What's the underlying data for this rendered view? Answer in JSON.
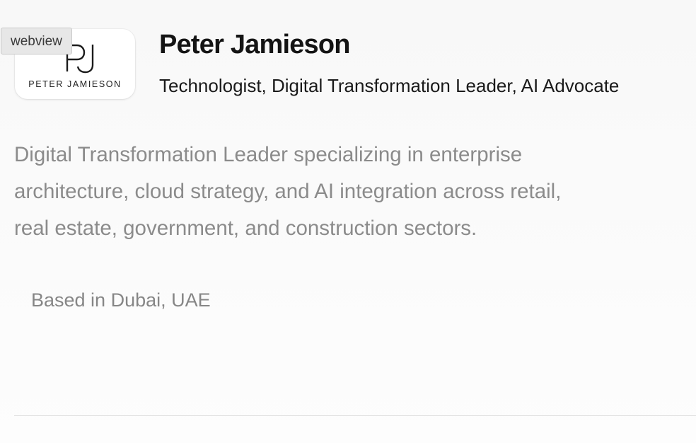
{
  "overlay": {
    "webview_label": "webview"
  },
  "profile": {
    "logo": {
      "monogram": "PJ",
      "wordmark": "PETER JAMIESON"
    },
    "name": "Peter Jamieson",
    "subtitle": "Technologist, Digital Transformation Leader, AI Advocate",
    "bio_lines": [
      "Digital Transformation Leader specializing in enterprise",
      "architecture, cloud strategy, and AI integration across retail,",
      "real estate, government, and construction sectors."
    ],
    "location": "Based in Dubai, UAE"
  }
}
